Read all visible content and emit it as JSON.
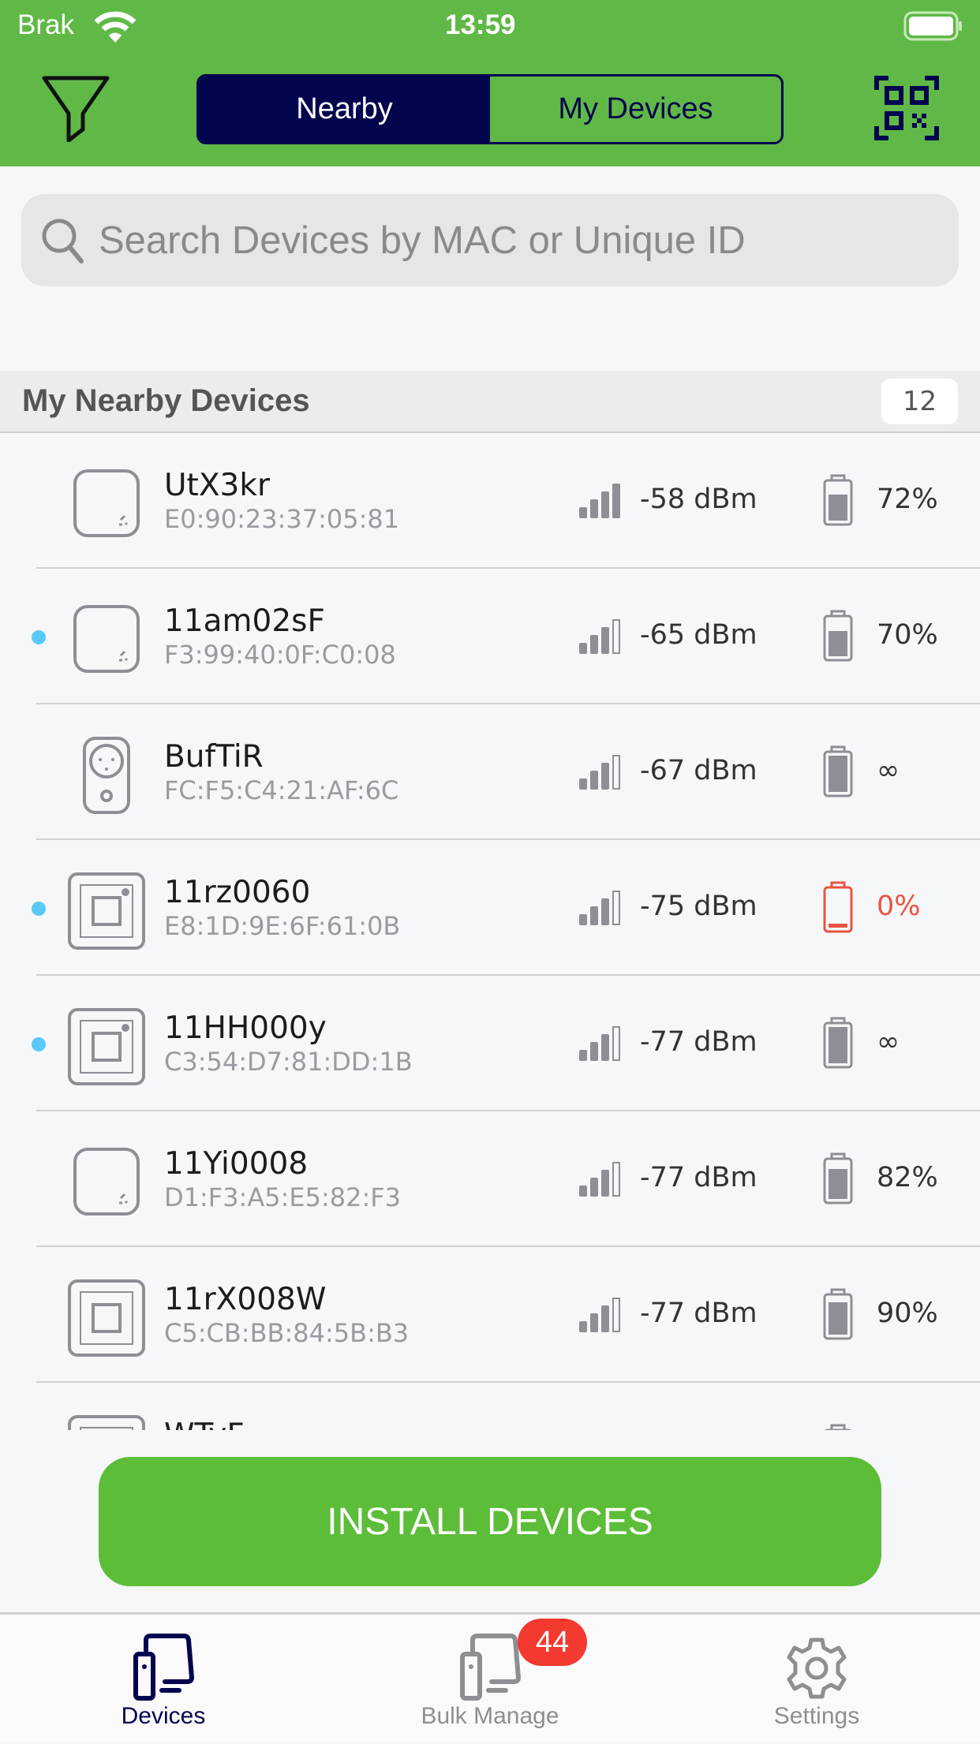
{
  "status_bar": {
    "carrier": "Brak",
    "time": "13:59"
  },
  "header": {
    "tabs": [
      {
        "label": "Nearby",
        "active": true
      },
      {
        "label": "My Devices",
        "active": false
      }
    ]
  },
  "search": {
    "placeholder": "Search Devices by MAC or Unique ID",
    "value": ""
  },
  "section": {
    "title": "My Nearby Devices",
    "count": "12"
  },
  "colors": {
    "brand_green": "#60b946",
    "navy": "#03044e",
    "unread_dot": "#5ac8fa",
    "battery_low": "#e8553f",
    "badge": "#f23a30"
  },
  "devices": [
    {
      "name": "UtX3kr",
      "mac": "E0:90:23:37:05:81",
      "rssi": "-58 dBm",
      "signal_bars": 3,
      "battery": "72%",
      "battery_level": 0.72,
      "icon": "sensor-icon",
      "unread": false,
      "low": false
    },
    {
      "name": "11am02sF",
      "mac": "F3:99:40:0F:C0:08",
      "rssi": "-65 dBm",
      "signal_bars": 2,
      "battery": "70%",
      "battery_level": 0.7,
      "icon": "sensor-icon",
      "unread": true,
      "low": false
    },
    {
      "name": "BufTiR",
      "mac": "FC:F5:C4:21:AF:6C",
      "rssi": "-67 dBm",
      "signal_bars": 2,
      "battery": "∞",
      "battery_level": 1,
      "icon": "plug-icon",
      "unread": false,
      "low": false
    },
    {
      "name": "11rz0060",
      "mac": "E8:1D:9E:6F:61:0B",
      "rssi": "-75 dBm",
      "signal_bars": 2,
      "battery": "0%",
      "battery_level": 0.1,
      "icon": "gateway-icon",
      "unread": true,
      "low": true
    },
    {
      "name": "11HH000y",
      "mac": "C3:54:D7:81:DD:1B",
      "rssi": "-77 dBm",
      "signal_bars": 2,
      "battery": "∞",
      "battery_level": 1,
      "icon": "gateway-icon",
      "unread": true,
      "low": false
    },
    {
      "name": "11Yi0008",
      "mac": "D1:F3:A5:E5:82:F3",
      "rssi": "-77 dBm",
      "signal_bars": 2,
      "battery": "82%",
      "battery_level": 0.82,
      "icon": "sensor-icon",
      "unread": false,
      "low": false
    },
    {
      "name": "11rX008W",
      "mac": "C5:CB:BB:84:5B:B3",
      "rssi": "-77 dBm",
      "signal_bars": 2,
      "battery": "90%",
      "battery_level": 0.9,
      "icon": "box-icon",
      "unread": false,
      "low": false
    },
    {
      "name": "WTyF",
      "mac": "",
      "rssi": "",
      "signal_bars": 2,
      "battery": "",
      "battery_level": 0.8,
      "icon": "box-icon",
      "unread": false,
      "low": false
    }
  ],
  "install_button": "INSTALL DEVICES",
  "tabbar": {
    "items": [
      {
        "label": "Devices",
        "active": true
      },
      {
        "label": "Bulk Manage",
        "active": false,
        "badge": "44"
      },
      {
        "label": "Settings",
        "active": false
      }
    ]
  }
}
